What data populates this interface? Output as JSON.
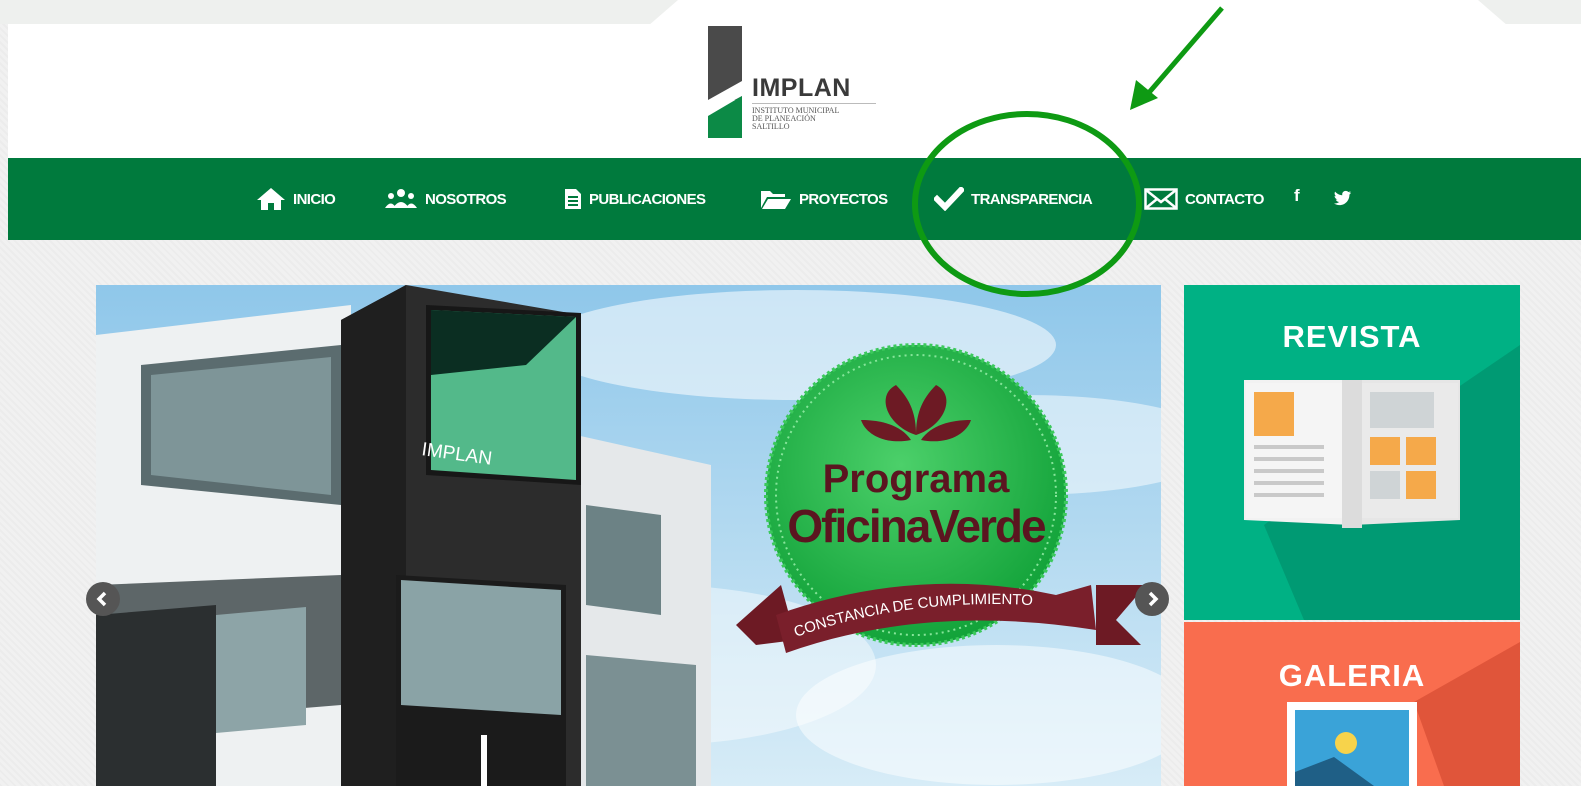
{
  "logo": {
    "name": "IMPLAN",
    "subtitle_lines": [
      "INSTITUTO MUNICIPAL",
      "DE PLANEACIÓN",
      "SALTILLO"
    ]
  },
  "nav": {
    "items": [
      {
        "label": "INICIO",
        "icon": "home-icon"
      },
      {
        "label": "NOSOTROS",
        "icon": "users-icon"
      },
      {
        "label": "PUBLICACIONES",
        "icon": "document-icon"
      },
      {
        "label": "PROYECTOS",
        "icon": "folder-open-icon"
      },
      {
        "label": "TRANSPARENCIA",
        "icon": "check-icon"
      },
      {
        "label": "CONTACTO",
        "icon": "envelope-icon"
      }
    ],
    "social": {
      "facebook": "f",
      "twitter": "twitter-icon"
    }
  },
  "slider": {
    "badge_line1": "Programa",
    "badge_line2": "OficinaVerde",
    "ribbon_text": "CONSTANCIA DE CUMPLIMIENTO",
    "building_sign": "IMPLAN"
  },
  "tiles": {
    "revista": {
      "title": "REVISTA",
      "color": "#00b184"
    },
    "galeria": {
      "title": "GALERIA",
      "color": "#f96d4e"
    }
  },
  "colors": {
    "nav_green": "#007a3d",
    "annotation_green": "#0e9a13"
  }
}
